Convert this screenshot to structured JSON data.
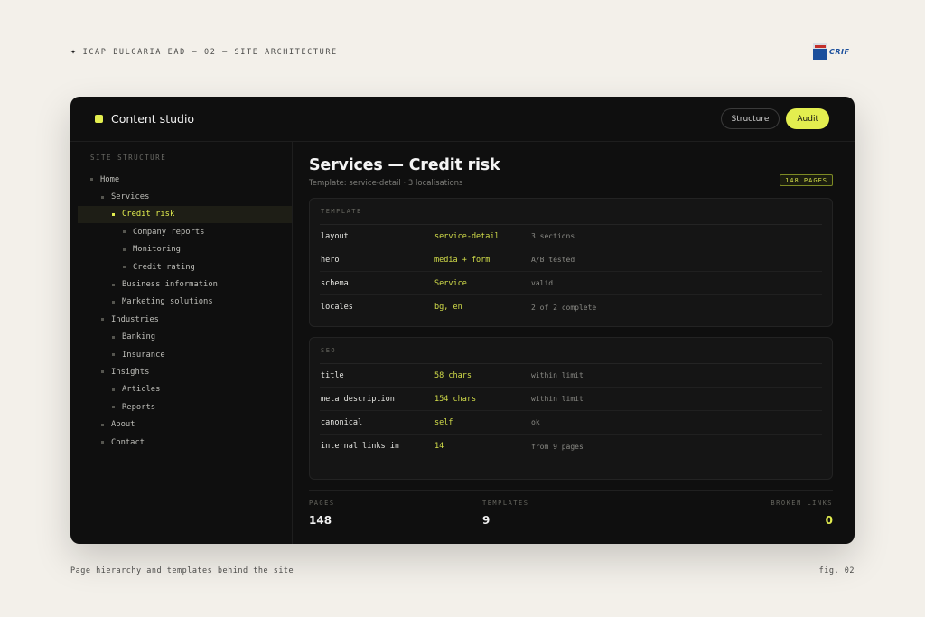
{
  "page": {
    "header": "ICAP BULGARIA EAD — 02 — SITE ARCHITECTURE",
    "logo_text": "CRIF",
    "caption": "Page hierarchy and templates behind the site",
    "fig_label": "fig. 02"
  },
  "app": {
    "title": "Content studio",
    "accent": "#e3ee4f",
    "buttons": {
      "structure": "Structure",
      "audit": "Audit"
    }
  },
  "sidebar": {
    "title": "SITE STRUCTURE",
    "items": [
      {
        "label": "Home",
        "level": 0
      },
      {
        "label": "Services",
        "level": 1
      },
      {
        "label": "Credit risk",
        "level": 2,
        "active": true
      },
      {
        "label": "Company reports",
        "level": 3
      },
      {
        "label": "Monitoring",
        "level": 3
      },
      {
        "label": "Credit rating",
        "level": 3
      },
      {
        "label": "Business information",
        "level": 2
      },
      {
        "label": "Marketing solutions",
        "level": 2
      },
      {
        "label": "Industries",
        "level": 1
      },
      {
        "label": "Banking",
        "level": 2
      },
      {
        "label": "Insurance",
        "level": 2
      },
      {
        "label": "Insights",
        "level": 1
      },
      {
        "label": "Articles",
        "level": 2
      },
      {
        "label": "Reports",
        "level": 2
      },
      {
        "label": "About",
        "level": 1
      },
      {
        "label": "Contact",
        "level": 1
      }
    ]
  },
  "main": {
    "title": "Services — Credit risk",
    "subtitle": "Template: service-detail · 3 localisations",
    "badge": "148 PAGES",
    "template_card": {
      "title": "TEMPLATE",
      "rows": [
        {
          "key": "layout",
          "value": "service-detail",
          "note": "3 sections"
        },
        {
          "key": "hero",
          "value": "media + form",
          "note": "A/B tested"
        },
        {
          "key": "schema",
          "value": "Service",
          "note": "valid"
        },
        {
          "key": "locales",
          "value": "bg, en",
          "note": "2 of 2 complete"
        }
      ]
    },
    "seo_card": {
      "title": "SEO",
      "rows": [
        {
          "key": "title",
          "value": "58 chars",
          "note": "within limit"
        },
        {
          "key": "meta description",
          "value": "154 chars",
          "note": "within limit"
        },
        {
          "key": "canonical",
          "value": "self",
          "note": "ok"
        },
        {
          "key": "internal links in",
          "value": "14",
          "note": "from 9 pages"
        }
      ]
    },
    "stats": [
      {
        "label": "PAGES",
        "value": "148"
      },
      {
        "label": "TEMPLATES",
        "value": "9"
      },
      {
        "label": "BROKEN LINKS",
        "value": "0"
      }
    ]
  }
}
